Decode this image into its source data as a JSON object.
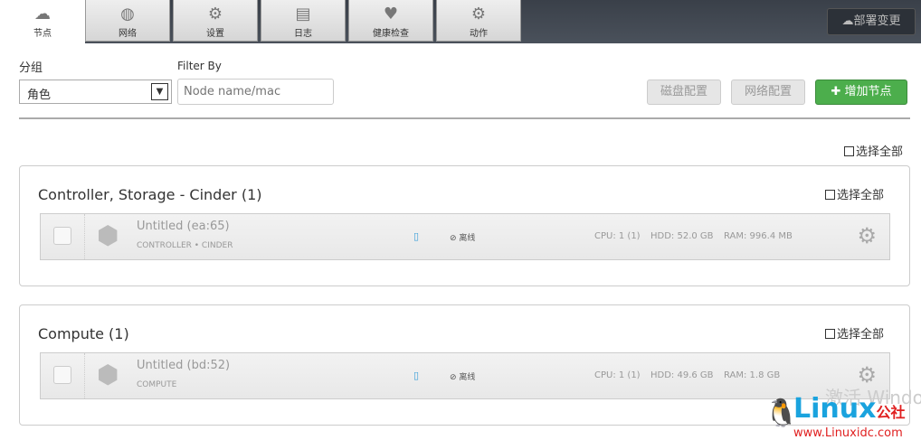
{
  "tabs": [
    {
      "label": "节点",
      "icon": "cloud-icon",
      "active": true
    },
    {
      "label": "网络",
      "icon": "globe-icon"
    },
    {
      "label": "设置",
      "icon": "gear-icon"
    },
    {
      "label": "日志",
      "icon": "clipboard-icon"
    },
    {
      "label": "健康检查",
      "icon": "heartbeat-icon"
    },
    {
      "label": "动作",
      "icon": "gears-icon"
    }
  ],
  "deploy_label": "部署变更",
  "group_label": "分组",
  "group_value": "角色",
  "filter_label": "Filter By",
  "filter_placeholder": "Node name/mac",
  "disk_btn": "磁盘配置",
  "net_btn": "网络配置",
  "add_btn": "增加节点",
  "select_all": "选择全部",
  "groups": [
    {
      "title": "Controller, Storage - Cinder (1)",
      "select_all": "选择全部",
      "nodes": [
        {
          "name": "Untitled (ea:65)",
          "roles": "CONTROLLER • CINDER",
          "status": "离线",
          "cpu": "CPU: 1 (1)",
          "hdd": "HDD: 52.0 GB",
          "ram": "RAM: 996.4 MB"
        }
      ]
    },
    {
      "title": "Compute (1)",
      "select_all": "选择全部",
      "nodes": [
        {
          "name": "Untitled (bd:52)",
          "roles": "COMPUTE",
          "status": "离线",
          "cpu": "CPU: 1 (1)",
          "hdd": "HDD: 49.6 GB",
          "ram": "RAM: 1.8 GB"
        }
      ]
    }
  ],
  "watermark": "激活 Windo",
  "logo": {
    "brand": "Linux",
    "suffix": "公社",
    "url": "www.Linuxidc.com"
  }
}
